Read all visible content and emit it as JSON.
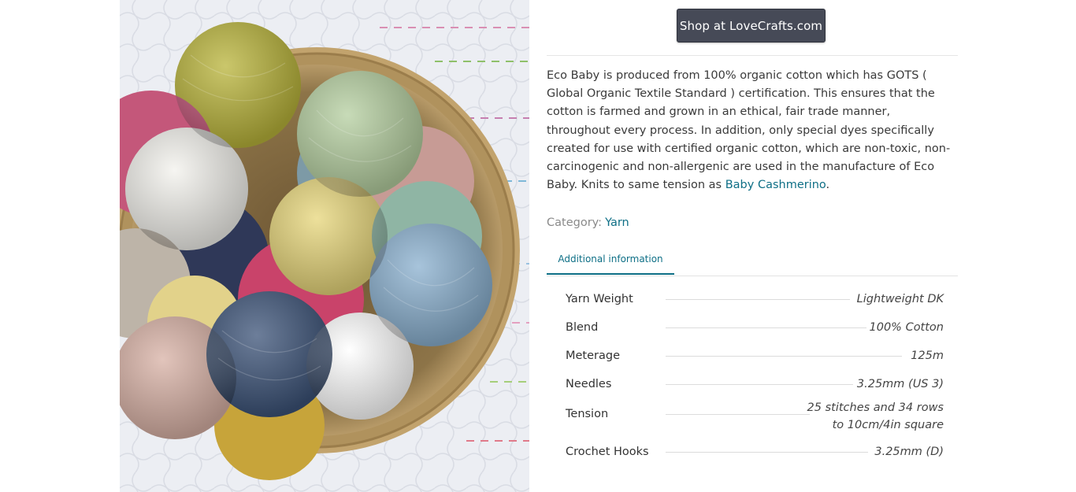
{
  "shop_button": {
    "label": "Shop at LoveCrafts.com"
  },
  "description": {
    "text_before_link": "Eco Baby is produced from 100% organic cotton which has GOTS ( Global Organic Textile Standard ) certification. This ensures that the cotton is farmed and grown in an ethical, fair trade manner, throughout every process. In addition, only special dyes specifically created for use with certified organic cotton, which are non-toxic, non-carcinogenic and non-allergenic are used in the manufacture of Eco Baby. Knits to same tension as",
    "link_text": "Baby Cashmerino",
    "text_after_link": "."
  },
  "category": {
    "label": "Category:",
    "value": "Yarn"
  },
  "tabs": [
    {
      "label": "Additional information"
    }
  ],
  "attributes": [
    {
      "name": "Yarn Weight",
      "value": "Lightweight DK"
    },
    {
      "name": "Blend",
      "value": "100% Cotton"
    },
    {
      "name": "Meterage",
      "value": "125m"
    },
    {
      "name": "Needles",
      "value": "3.25mm (US 3)"
    },
    {
      "name": "Tension",
      "value_line1": "25 stitches and 34 rows",
      "value_line2": "to 10cm/4in square"
    },
    {
      "name": "Crochet Hooks",
      "value": "3.25mm (D)"
    }
  ],
  "colors": {
    "accent": "#0e6f86",
    "button_bg": "#464a57"
  }
}
